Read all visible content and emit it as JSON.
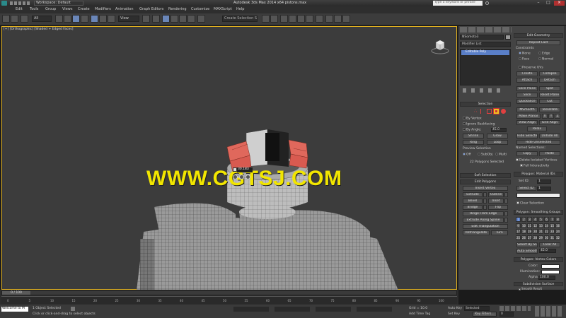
{
  "titlebar": {
    "workspace": "Workspace: Default",
    "title": "Autodesk 3ds Max  2014 x64     pistons.max",
    "search_placeholder": "Type a keyword or phrase"
  },
  "menu": [
    "Edit",
    "Tools",
    "Group",
    "Views",
    "Create",
    "Modifiers",
    "Animation",
    "Graph Editors",
    "Rendering",
    "Customize",
    "MAXScript",
    "Help"
  ],
  "toolbar": {
    "filter": "All",
    "view": "View",
    "selection_set": "Create Selection S"
  },
  "viewport": {
    "label": "[+] [Orthographic] [Shaded + Edged Faces]",
    "caddy_value": "30.183"
  },
  "watermark": "WWW.CGTSJ.COM",
  "cmdpanel": {
    "object_name": "NSomoto3",
    "modifier_list": "Modifier List",
    "stack_item": "Editable Poly",
    "selection_head": "Selection",
    "by_vertex": "By Vertex",
    "ignore_backfacing": "Ignore Backfacing",
    "by_angle": "By Angle:",
    "by_angle_value": "45.0",
    "shrink": "Shrink",
    "grow": "Grow",
    "ring": "Ring",
    "loop": "Loop",
    "preview_selection": "Preview Selection",
    "off": "Off",
    "subobj": "SubObj",
    "multi": "Multi",
    "selected_info": "22 Polygons Selected",
    "soft_selection": "Soft Selection",
    "edit_polygons": "Edit Polygons",
    "insert_vertex": "Insert Vertex",
    "extrude": "Extrude",
    "outline": "Outline",
    "bevel": "Bevel",
    "inset": "Inset",
    "bridge": "Bridge",
    "flip": "Flip",
    "hinge": "Hinge From Edge",
    "extrude_spline": "Extrude Along Spline",
    "edit_triangulation": "Edit Triangulation",
    "retriangulate": "Retriangulate",
    "turn": "Turn"
  },
  "rollout": {
    "edit_geometry": "Edit Geometry",
    "repeat_last": "Repeat Last",
    "constraints": "Constraints",
    "none": "None",
    "edge": "Edge",
    "face": "Face",
    "normal": "Normal",
    "preserve_uvs": "Preserve UVs",
    "create": "Create",
    "collapse": "Collapse",
    "attach": "Attach",
    "detach": "Detach",
    "slice_plane": "Slice Plane",
    "split": "Split",
    "slice": "Slice",
    "reset_plane": "Reset Plane",
    "quickslice": "QuickSlice",
    "cut": "Cut",
    "msmooth": "MSmooth",
    "tessellate": "Tessellate",
    "make_planar": "Make Planar",
    "x": "X",
    "y": "Y",
    "z": "Z",
    "view_align": "View Align",
    "grid_align": "Grid Align",
    "relax": "Relax",
    "hide_selected": "Hide Selected",
    "unhide_all": "Unhide All",
    "hide_unselected": "Hide Unselected",
    "named_selections": "Named Selections:",
    "copy": "Copy",
    "paste": "Paste",
    "delete_isolated": "Delete Isolated Vertices",
    "full_interactivity": "Full Interactivity",
    "material_ids": "Polygon: Material IDs",
    "set_id": "Set ID:",
    "set_id_value": "1",
    "select_id": "Select ID",
    "select_id_value": "1",
    "clear_selection": "Clear Selection",
    "smoothing_groups": "Polygon: Smoothing Groups",
    "sg_numbers": [
      "1",
      "2",
      "3",
      "4",
      "5",
      "6",
      "7",
      "8",
      "9",
      "10",
      "11",
      "12",
      "13",
      "14",
      "15",
      "16",
      "17",
      "18",
      "19",
      "20",
      "21",
      "22",
      "23",
      "24",
      "25",
      "26",
      "27",
      "28",
      "29",
      "30",
      "31",
      "32"
    ],
    "select_by_sg": "Select By SG",
    "clear_all": "Clear All",
    "auto_smooth": "Auto Smooth",
    "auto_smooth_value": "45.0",
    "vertex_colors": "Polygon: Vertex Colors",
    "color": "Color:",
    "illumination": "Illumination:",
    "alpha": "Alpha:",
    "alpha_value": "100.0",
    "subdivision_surface": "Subdivision Surface",
    "smooth_result": "Smooth Result"
  },
  "timeline": {
    "frame": "0 / 100",
    "ticks": [
      "0",
      "5",
      "10",
      "15",
      "20",
      "25",
      "30",
      "35",
      "40",
      "45",
      "50",
      "55",
      "60",
      "65",
      "70",
      "75",
      "80",
      "85",
      "90",
      "95",
      "100"
    ]
  },
  "status": {
    "welcome": "Welcome to M",
    "objects_selected": "1 Object Selected",
    "prompt": "Click or click-and-drag to select objects",
    "grid": "Grid = 10.0",
    "add_time_tag": "Add Time Tag",
    "auto_key": "Auto Key",
    "auto_key_mode": "Selected",
    "set_key": "Set Key",
    "key_filters": "Key Filters...",
    "frame_value": "0"
  },
  "colors": {
    "selection_red": "#e0685c",
    "watermark": "#f2e600",
    "viewport_border": "#e0b020"
  }
}
